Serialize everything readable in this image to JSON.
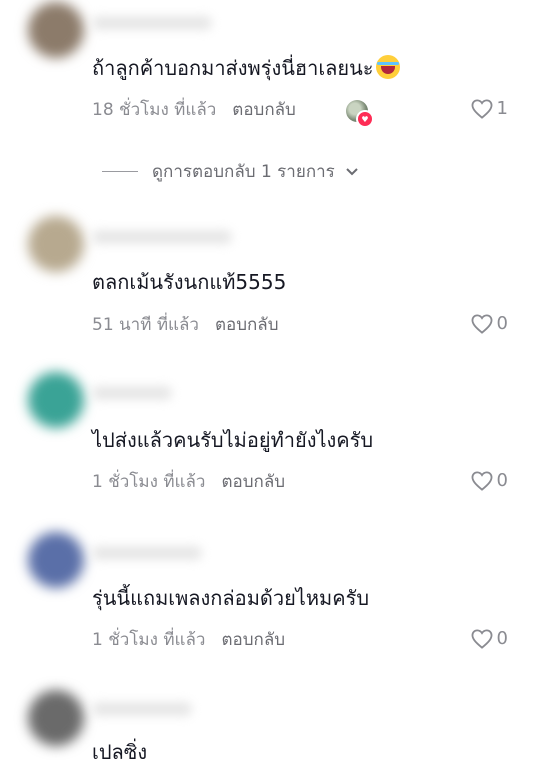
{
  "comments": [
    {
      "text": "ถ้าลูกค้าบอกมาส่งพรุ่งนี่ฮาเลยนะ",
      "time": "18 ชั่วโมง ที่แล้ว",
      "reply": "ตอบกลับ",
      "likes": "1",
      "avatar_color": "#8c7b6a",
      "emoji": "rolling-on-floor-laughing"
    },
    {
      "text": "ตลกเม้นรังนกแท้5555",
      "time": "51 นาที ที่แล้ว",
      "reply": "ตอบกลับ",
      "likes": "0",
      "avatar_color": "#b7a98f"
    },
    {
      "text": "ไปส่งแล้วคนรับไม่อยู่ทำยังไงครับ",
      "time": "1 ชั่วโมง ที่แล้ว",
      "reply": "ตอบกลับ",
      "likes": "0",
      "avatar_color": "#3aa396"
    },
    {
      "text": "รุ่นนี้แถมเพลงกล่อมด้วยไหมครับ",
      "time": "1 ชั่วโมง ที่แล้ว",
      "reply": "ตอบกลับ",
      "likes": "0",
      "avatar_color": "#5a6fa8"
    },
    {
      "text": "เปลซิ่ง",
      "avatar_color": "#6a6a6a"
    }
  ],
  "view_replies": "ดูการตอบกลับ 1 รายการ",
  "colors": {
    "accent": "#fe2c55",
    "muted": "#8a8b91"
  }
}
